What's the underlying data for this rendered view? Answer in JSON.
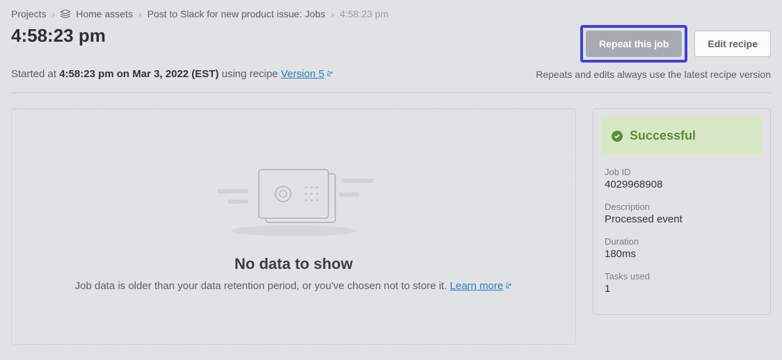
{
  "breadcrumb": {
    "projects": "Projects",
    "home_assets": "Home assets",
    "recipe": "Post to Slack for new product issue: Jobs",
    "current": "4:58:23 pm"
  },
  "page_title": "4:58:23 pm",
  "buttons": {
    "repeat": "Repeat this job",
    "edit": "Edit recipe"
  },
  "subheader": {
    "started_prefix": "Started at ",
    "started_time": "4:58:23 pm on Mar 3, 2022 (EST)",
    "using_prefix": " using recipe ",
    "version_link": "Version 5",
    "note": "Repeats and edits always use the latest recipe version"
  },
  "empty_state": {
    "title": "No data to show",
    "desc_prefix": "Job data is older than your data retention period, or you've chosen not to store it. ",
    "learn_more": "Learn more"
  },
  "status": {
    "label": "Successful"
  },
  "meta": {
    "job_id_label": "Job ID",
    "job_id_value": "4029968908",
    "description_label": "Description",
    "description_value": "Processed event",
    "duration_label": "Duration",
    "duration_value": "180ms",
    "tasks_label": "Tasks used",
    "tasks_value": "1"
  }
}
